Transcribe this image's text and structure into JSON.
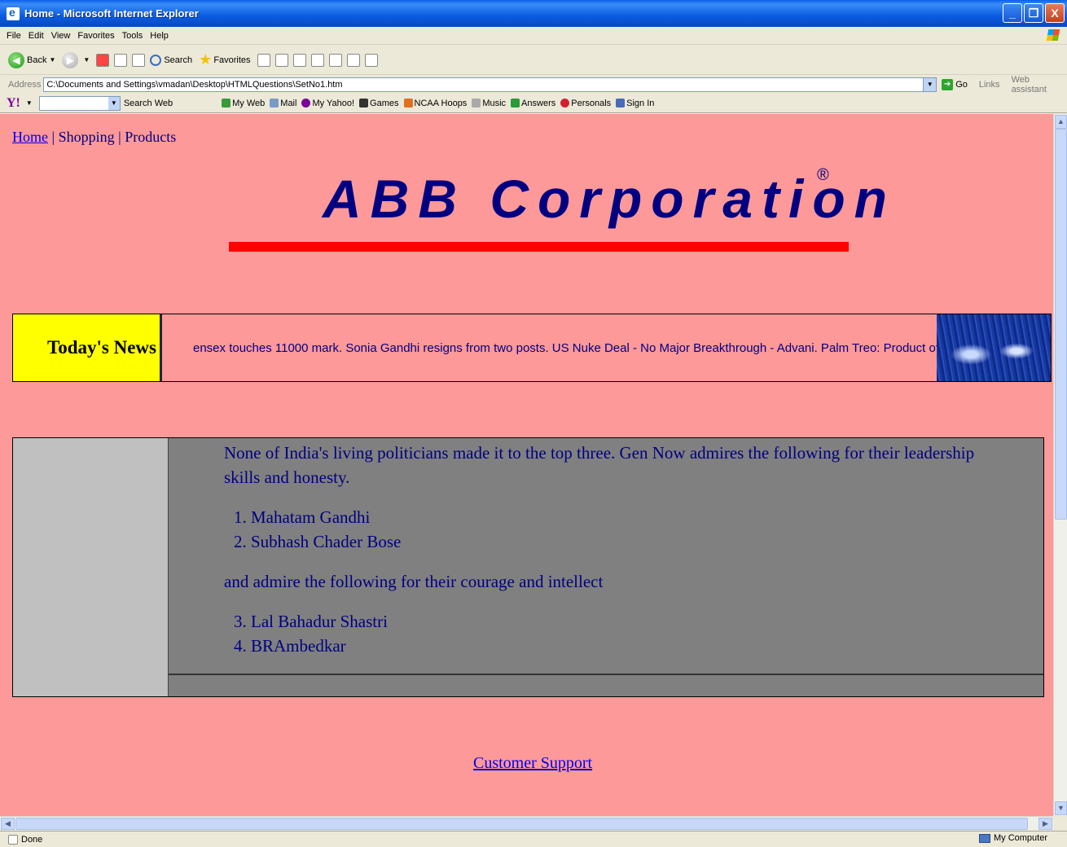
{
  "window": {
    "title": "Home - Microsoft Internet Explorer",
    "buttons": [
      "_",
      "❐",
      "X"
    ]
  },
  "menu": [
    "File",
    "Edit",
    "View",
    "Favorites",
    "Tools",
    "Help"
  ],
  "toolbar": {
    "back": "Back",
    "search": "Search",
    "favorites": "Favorites"
  },
  "address": {
    "label": "Address",
    "value": "C:\\Documents and Settings\\vmadan\\Desktop\\HTMLQuestions\\SetNo1.htm",
    "go": "Go",
    "links": "Links",
    "web_assistant": "Web assistant"
  },
  "yahoo": {
    "logo": "Y!",
    "search_web": "Search Web",
    "items": [
      "My Web",
      "Mail",
      "My Yahoo!",
      "Games",
      "NCAA Hoops",
      "Music",
      "Answers",
      "Personals",
      "Sign In"
    ]
  },
  "page": {
    "nav": {
      "home": "Home",
      "sep1": " | ",
      "shopping": "Shopping",
      "sep2": " | ",
      "products": "Products"
    },
    "logo": "ABB Corporation",
    "registered": "®",
    "news_label": "Today's News",
    "news_ticker": "ensex touches 11000 mark. Sonia Gandhi resigns from two posts. US Nuke Deal - No Major Breakthrough - Advani. Palm Treo: Product of the year",
    "intro": "None of India's living politicians made it to the top three. Gen Now admires the following for their leadership skills and honesty.",
    "list1": [
      "Mahatam Gandhi",
      "Subhash Chader Bose"
    ],
    "middle": "and admire the following for their courage and intellect",
    "list2": [
      "Lal Bahadur Shastri",
      "BRAmbedkar"
    ],
    "support": "Customer Support"
  },
  "status": {
    "left": "Done",
    "zone": "My Computer"
  },
  "colors": {
    "page_bg": "#fe9999",
    "logo": "#000080",
    "bar": "#fe0000",
    "news_label_bg": "#ffff00",
    "cell_bg": "#808080",
    "side_bg": "#c0c0c0"
  }
}
